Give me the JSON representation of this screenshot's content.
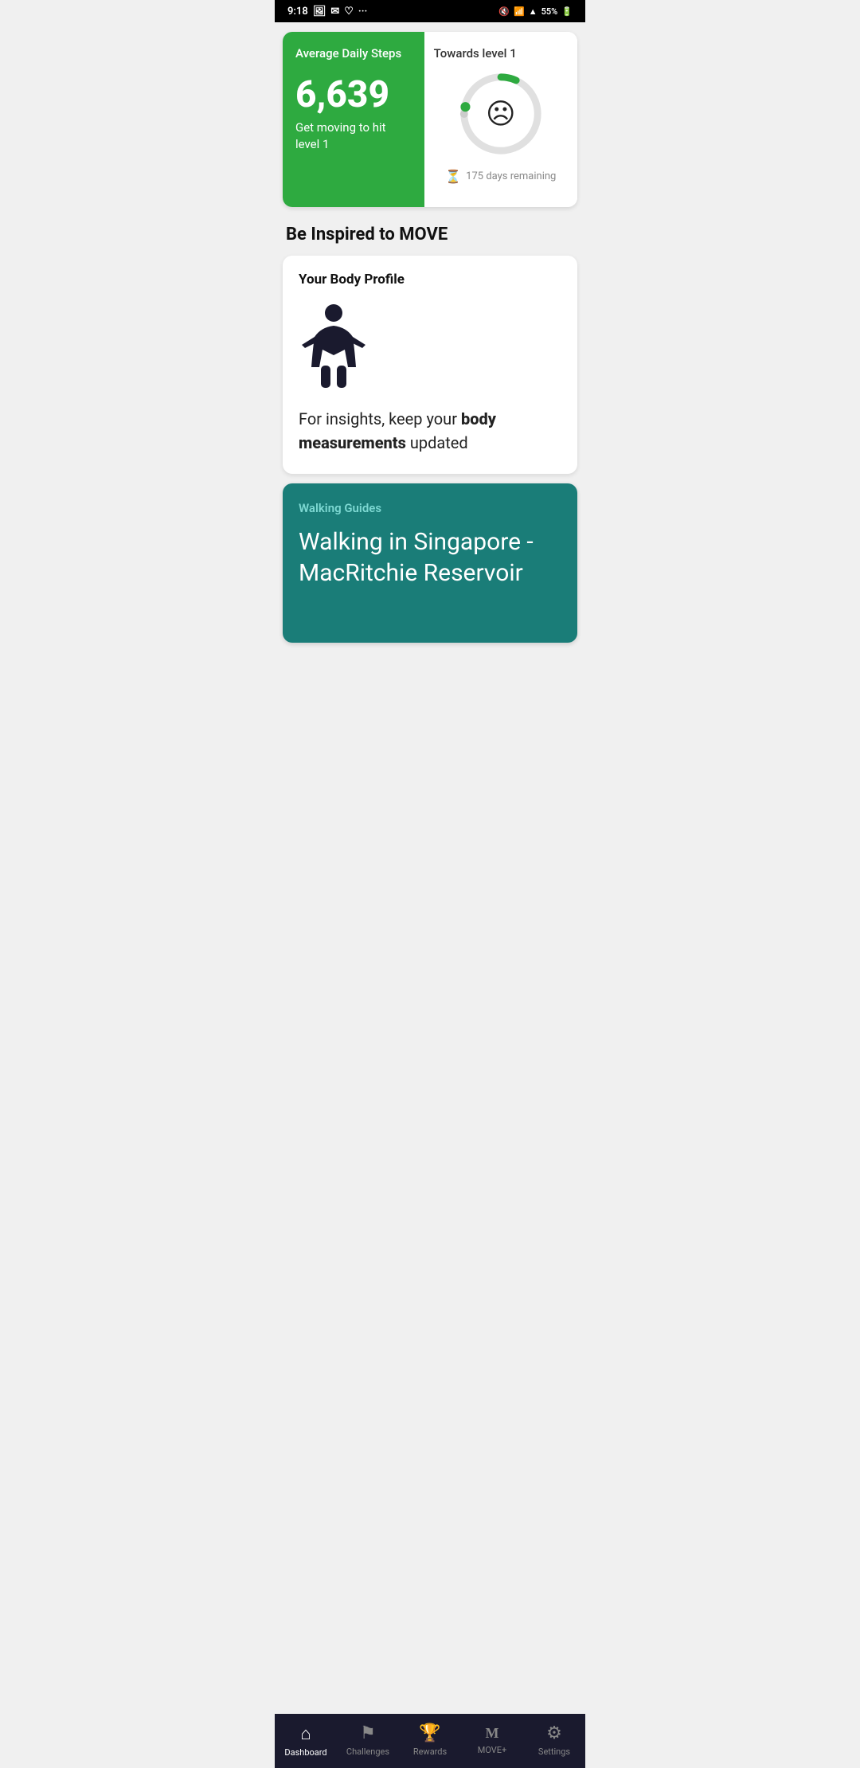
{
  "statusBar": {
    "time": "9:18",
    "battery": "55%"
  },
  "topCard": {
    "stepsLabel": "Average Daily Steps",
    "stepsValue": "6,639",
    "stepsSubtitle": "Get moving to hit level 1",
    "towardsLabel": "Towards level 1",
    "daysRemaining": "175 days remaining",
    "progressPercent": 6
  },
  "sections": {
    "inspiredTitle": "Be Inspired to MOVE",
    "bodyProfile": {
      "cardTitle": "Your Body Profile",
      "bodyText": "For insights, keep your ",
      "bodyTextBold": "body measurements",
      "bodyTextEnd": " updated"
    },
    "walkingGuides": {
      "label": "Walking Guides",
      "title": "Walking in Singapore - MacRitchie Reservoir"
    }
  },
  "bottomNav": {
    "items": [
      {
        "id": "dashboard",
        "label": "Dashboard",
        "icon": "🏠",
        "active": true
      },
      {
        "id": "challenges",
        "label": "Challenges",
        "icon": "⚑",
        "active": false
      },
      {
        "id": "rewards",
        "label": "Rewards",
        "icon": "🏆",
        "active": false
      },
      {
        "id": "move-plus",
        "label": "MOVE+",
        "icon": "M",
        "active": false
      },
      {
        "id": "settings",
        "label": "Settings",
        "icon": "⚙",
        "active": false
      }
    ]
  }
}
